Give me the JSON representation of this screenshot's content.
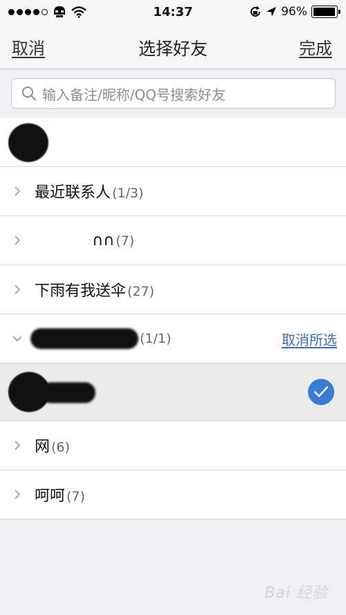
{
  "status_bar": {
    "time": "14:37",
    "battery_text": "96%",
    "battery_level": 0.96
  },
  "nav": {
    "cancel_label": "取消",
    "title": "选择好友",
    "done_label": "完成"
  },
  "search": {
    "placeholder": "输入备注/昵称/QQ号搜索好友"
  },
  "groups": [
    {
      "name": "最近联系人",
      "count": "(1/3)"
    },
    {
      "name": "∩∩",
      "count": "(7)"
    },
    {
      "name": "下雨有我送伞",
      "count": "(27)"
    },
    {
      "name": "",
      "count": "(1/1)",
      "action": "取消所选"
    },
    {
      "name": "网",
      "count": "(6)"
    },
    {
      "name": "呵呵",
      "count": "(7)"
    }
  ],
  "watermark": "Bai 经验",
  "colors": {
    "accent": "#3a7bd5",
    "link": "#3b6fb6",
    "background": "#efeff4"
  }
}
